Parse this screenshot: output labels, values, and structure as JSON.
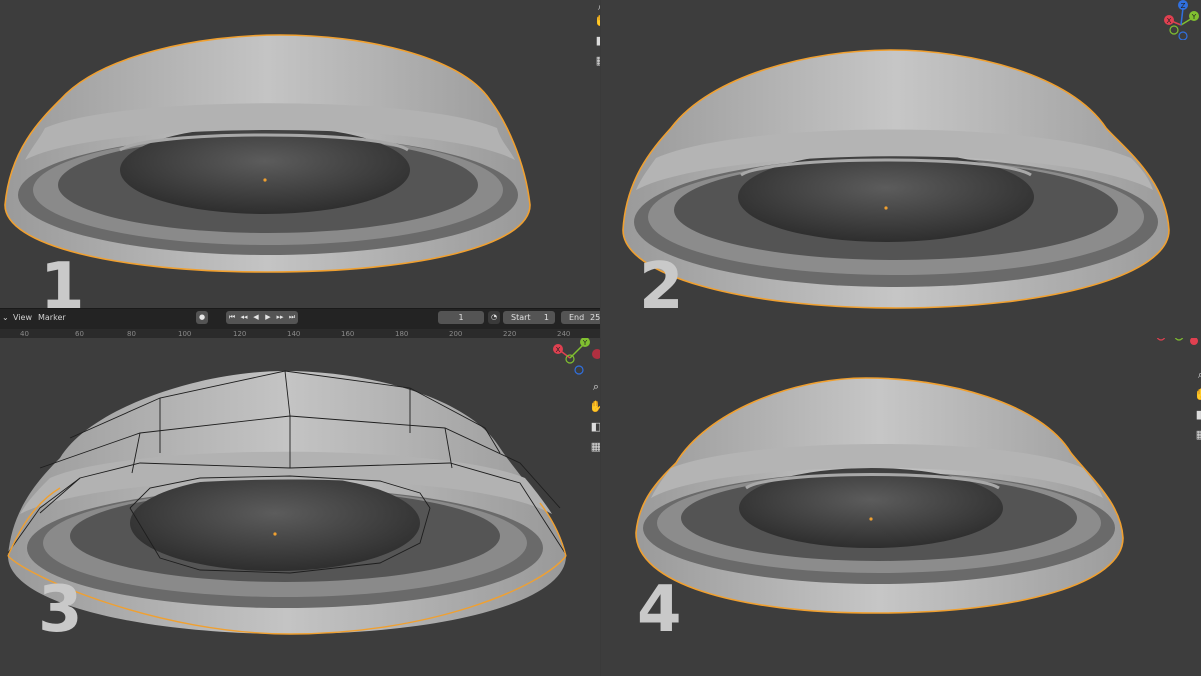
{
  "panels": [
    {
      "number_label": "1",
      "view": "wireframe-off"
    },
    {
      "number_label": "2",
      "view": "wireframe-off"
    },
    {
      "number_label": "3",
      "view": "wireframe-on"
    },
    {
      "number_label": "4",
      "view": "wireframe-off"
    }
  ],
  "gizmo": {
    "x_label": "X",
    "y_label": "Y",
    "z_label": "Z"
  },
  "timeline": {
    "view_menu": "View",
    "marker_menu": "Marker",
    "current_frame": "1",
    "start_label": "Start",
    "start_value": "1",
    "end_label": "End",
    "end_value": "25",
    "ticks": [
      "40",
      "60",
      "80",
      "100",
      "120",
      "140",
      "160",
      "180",
      "200",
      "220",
      "240"
    ]
  },
  "icons": {
    "zoom": "zoom-icon",
    "pan": "hand-icon",
    "camera": "camera-icon",
    "grid": "grid-icon"
  },
  "colors": {
    "background": "#3d3d3d",
    "outline": "#f0a030",
    "mesh": "#b8b8b8",
    "number_text": "#c9c9c9"
  }
}
